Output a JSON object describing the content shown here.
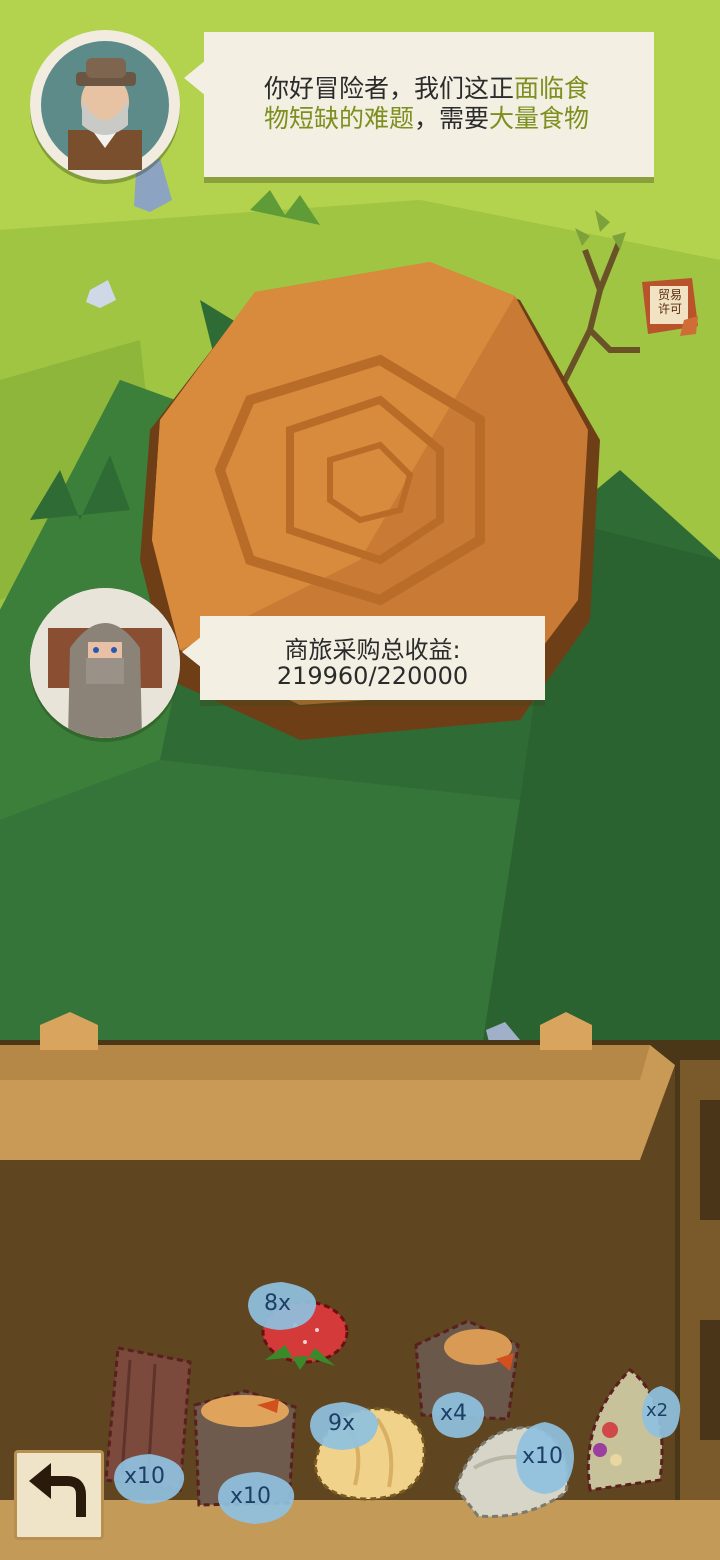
{
  "npc_dialog": {
    "line1_plain": "你好冒险者，我们这正",
    "line1_highlight": "面临食",
    "line2_highlight": "物短缺的难题",
    "line2_plain": "，需要",
    "line2_highlight2": "大量食物"
  },
  "caravan_dialog": {
    "label": "商旅采购总收益:",
    "progress_text": "219960/220000",
    "progress_value": 219960,
    "progress_total": 220000
  },
  "trade_permit": {
    "label_top": "贸易",
    "label_bottom": "许可",
    "icon": "trade-permit-scroll-icon"
  },
  "items": [
    {
      "name": "wood-plank",
      "count": "x10"
    },
    {
      "name": "tree-stump",
      "count": "x10"
    },
    {
      "name": "strawberry",
      "count": "8x"
    },
    {
      "name": "bread",
      "count": "9x"
    },
    {
      "name": "tree-stump-small",
      "count": "x4"
    },
    {
      "name": "dumpling",
      "count": "x10"
    },
    {
      "name": "taco",
      "count": "x2"
    }
  ],
  "colors": {
    "highlight_text": "#7d8f1e",
    "grass_light": "#a6c84a",
    "grass_dark": "#3a7a3a",
    "crate": "#5a4321",
    "badge": "#8fc1e0"
  },
  "back_button": {
    "icon": "back-arrow-icon"
  }
}
